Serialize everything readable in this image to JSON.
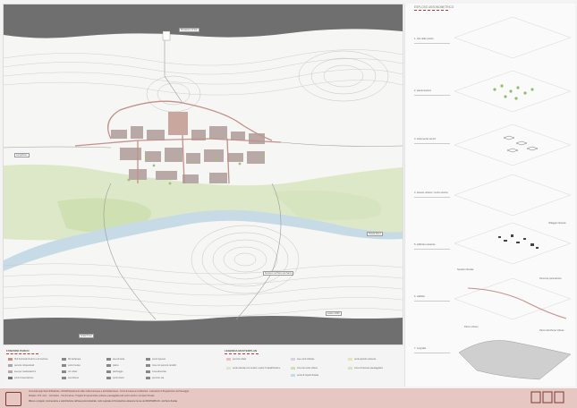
{
  "map": {
    "title": "MASTERPLAN DI PROGETTO",
    "labels": {
      "monastery": "Monastero di San",
      "riverside": "Lungofiume",
      "scale_note": "scala 1:2000",
      "sacred_hill": "Sentiero nel Parco del Sacro",
      "bottom_box": "Scala Provo",
      "right_road": "Strada Parco"
    }
  },
  "right_panel": {
    "title": "ESPLOSO ASSONOMETRICO",
    "layers": [
      {
        "label": "1. rete delle piazze"
      },
      {
        "label": "2. piantumazioni"
      },
      {
        "label": "3. sistema dei servizi"
      },
      {
        "label": "4. tessuto urbano / centro storico"
      },
      {
        "label": "5. edificato esistente"
      },
      {
        "label": "6. viabilità"
      },
      {
        "label": "7. orografia"
      }
    ],
    "callouts": {
      "c1": "Villaggio Operaio",
      "c2": "Sentiero fluviale",
      "c3": "Percorso panoramico",
      "c4": "Parco urbano",
      "c5": "Parco del Monte Vulture"
    }
  },
  "legend": {
    "title_left": "FUNZIONI PARCO",
    "items_left": [
      "Hub funzionali di arrivo e di ricezione",
      "percorsi ciclopedonali",
      "area per manifestazioni",
      "punti di osservazione"
    ],
    "items_mid": [
      "Siti dell'acqua",
      "punti di sosta",
      "orti urbani",
      "area fitness"
    ],
    "items_mid2": [
      "area di sosta",
      "piazze",
      "parcheggio",
      "punto ristoro"
    ],
    "items_mid3": [
      "punto ingresso",
      "zone con percorsi carrabili",
      "zona attrezzata",
      "percorso vita"
    ],
    "title_right": "LEGENDA MASTERPLAN",
    "items_right": [
      "percorsi urbani",
      "verde naturale con sentieri e spazi di riqualificazione",
      "aree verdi coltivate",
      "zone del verde urbano",
      "verde di rispetto fluviale",
      "verde agricolo esistente",
      "zone di interesse paesaggistico"
    ]
  },
  "footer": {
    "line1": "Università degli Studi di Basilicata - DiCEM Dipartimento delle Culture Europee e del Mediterraneo - Corso di Laurea in Architettura - Laboratorio di Progettazione del Paesaggio",
    "line2": "Relatore: Prof. Arch. - Correlatore - Tesi di Laurea - Progetto di rigenerazione urbana e paesaggistica del centro storico e del parco fluviale",
    "line3": "Rilievo e progetto, riconnessione e valorizzazione dell'area post-industriale, nodo regionale di Occupazione attraverso la rete del MASTERPLAN - del Parco fluviale",
    "accent": "#c0392b",
    "bg": "#e6c7c1"
  },
  "colors": {
    "green": "#c9ddb0",
    "river": "#c7dbe6",
    "built": "#b9a9a6",
    "road": "#c48f8a"
  }
}
